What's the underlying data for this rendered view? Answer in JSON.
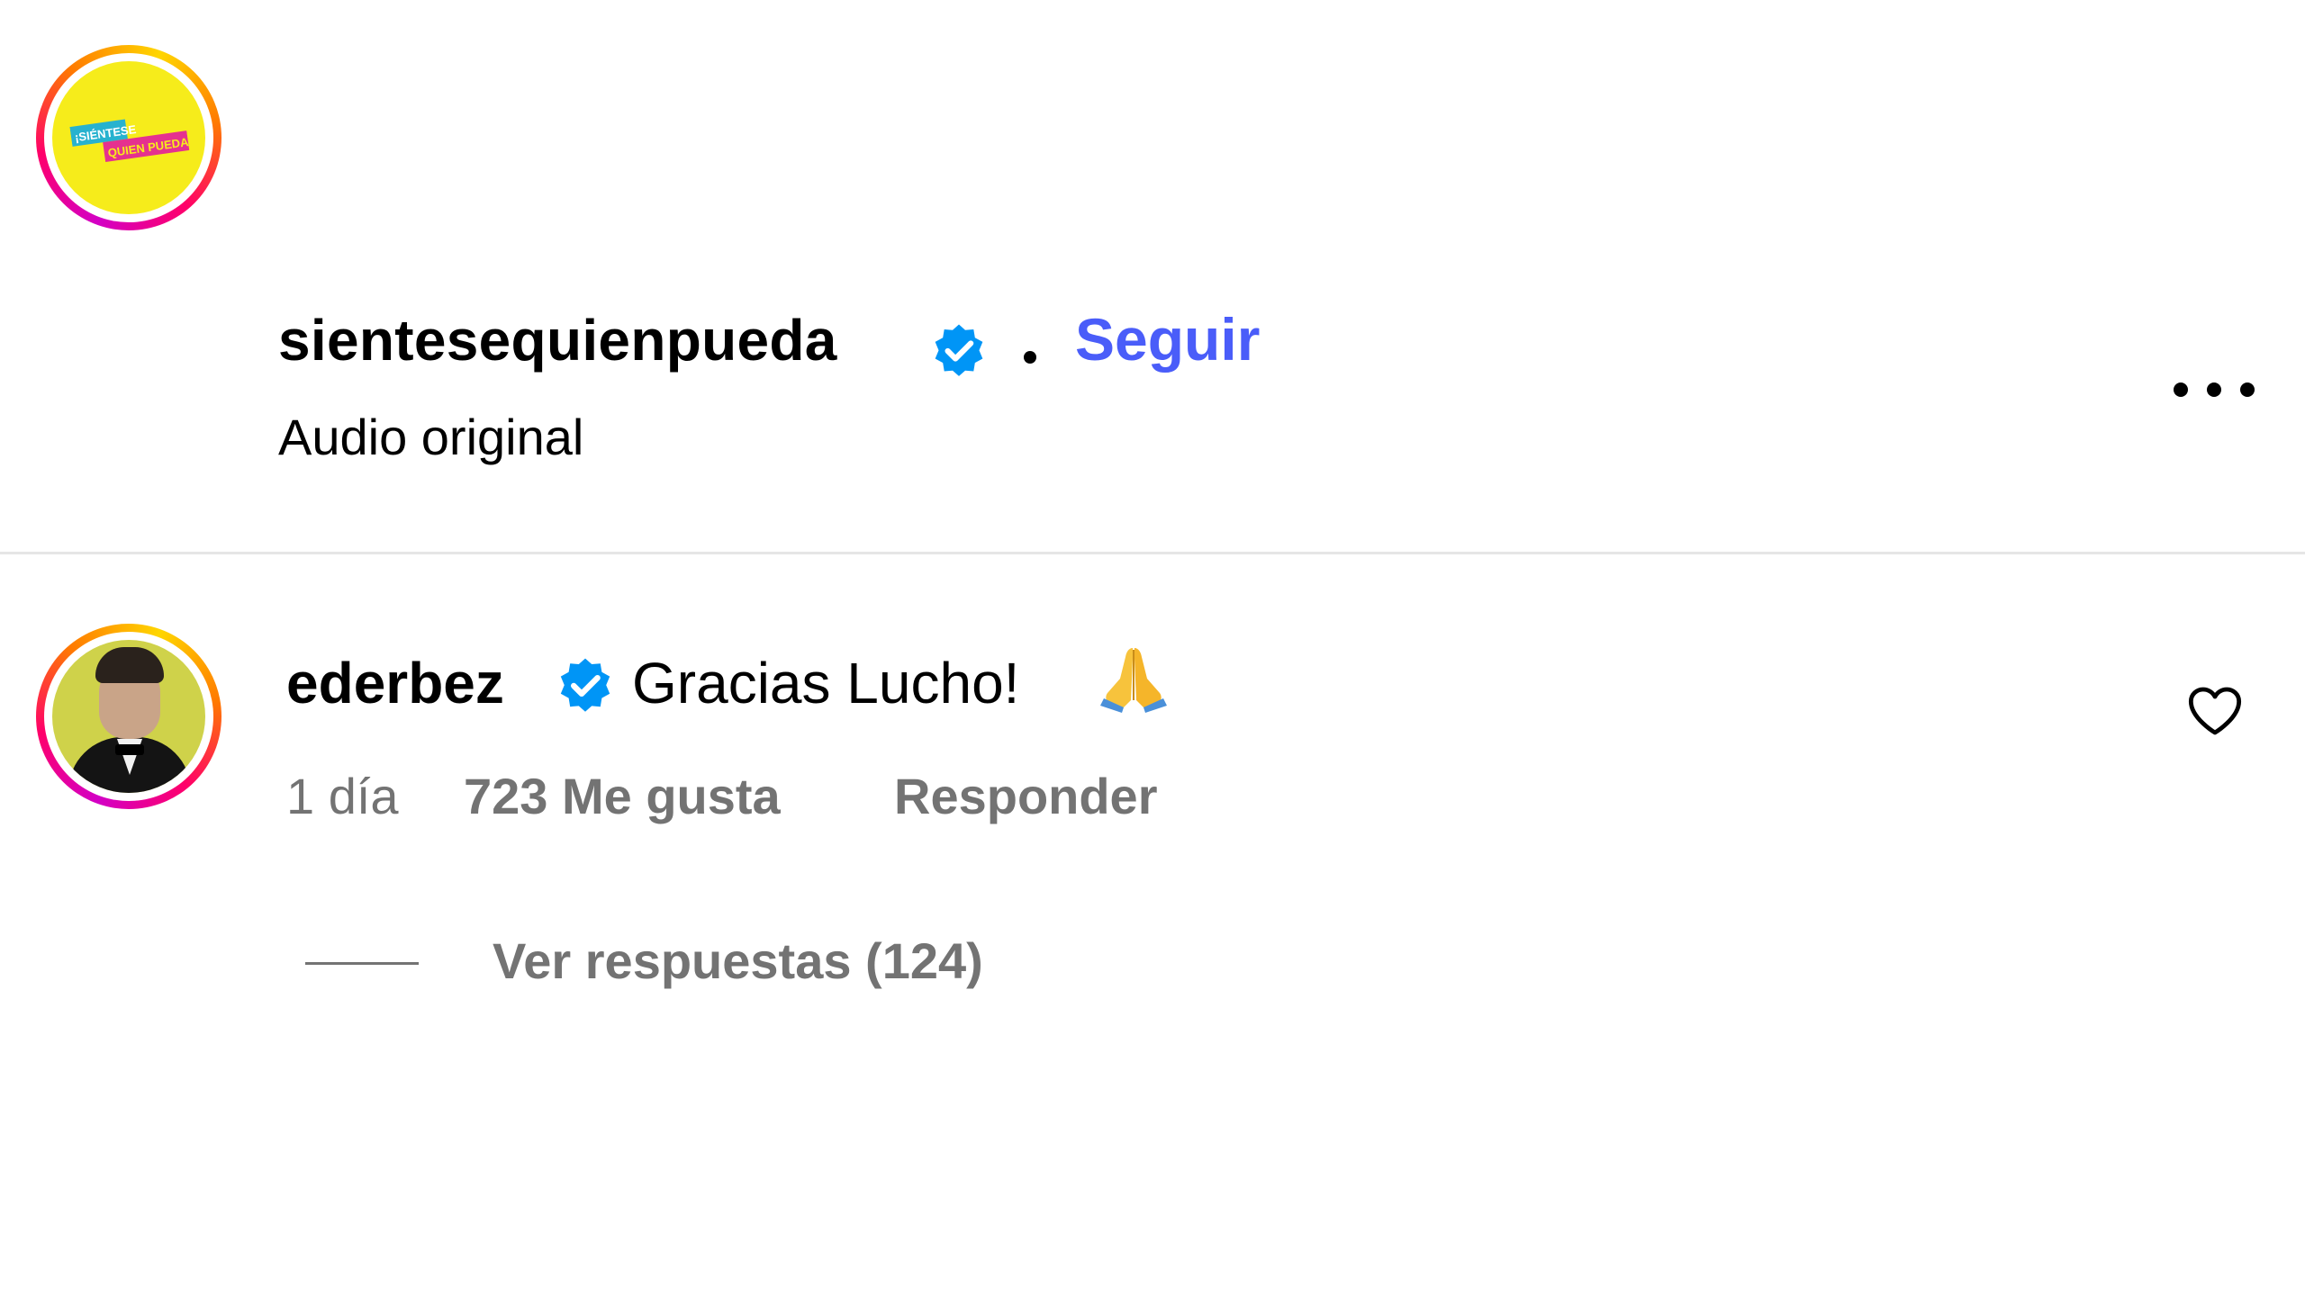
{
  "post": {
    "username": "sientesequienpueda",
    "verified": true,
    "follow_label": "Seguir",
    "audio_label": "Audio original",
    "avatar_logo_lines": [
      "¡SIÉNTESE",
      "QUIEN PUEDA!"
    ],
    "more_icon": "more-horizontal-icon"
  },
  "comment": {
    "username": "ederbez",
    "verified": true,
    "text": "Gracias Lucho!",
    "emoji": "🙏",
    "time": "1 día",
    "likes": "723 Me gusta",
    "reply_label": "Responder",
    "view_replies": "Ver respuestas (124)",
    "like_icon": "heart-outline-icon"
  },
  "colors": {
    "follow_accent": "#4a5df9",
    "verified_blue": "#0095f6",
    "muted_text": "#737373",
    "divider": "#e6e6e6"
  }
}
